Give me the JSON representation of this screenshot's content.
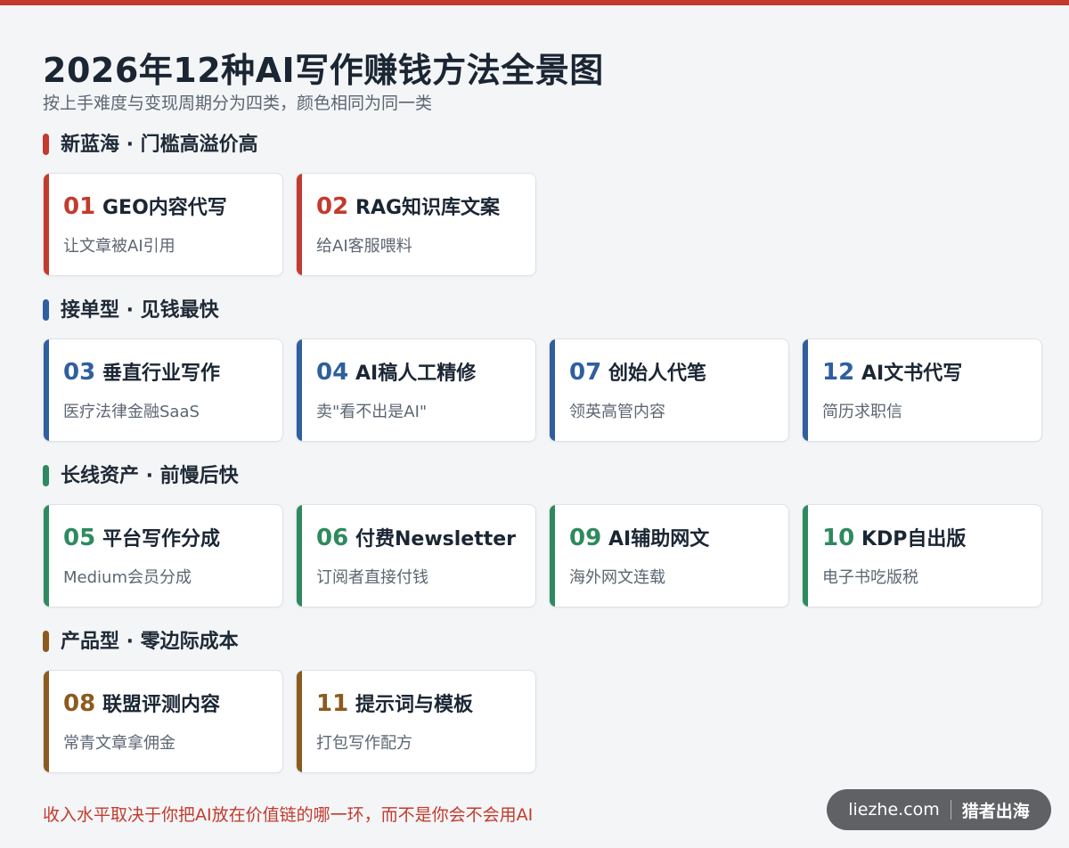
{
  "title": "2026年12种AI写作赚钱方法全景图",
  "subtitle": "按上手难度与变现周期分为四类，颜色相同为同一类",
  "colors": {
    "red": "#c23b2e",
    "blue": "#2f5f9e",
    "green": "#2e8a5e",
    "brown": "#8c5a1e"
  },
  "sections": [
    {
      "title": "新蓝海 · 门槛高溢价高",
      "color": "#c23b2e",
      "cards": [
        {
          "num": "01",
          "title": "GEO内容代写",
          "desc": "让文章被AI引用"
        },
        {
          "num": "02",
          "title": "RAG知识库文案",
          "desc": "给AI客服喂料"
        }
      ]
    },
    {
      "title": "接单型 · 见钱最快",
      "color": "#2f5f9e",
      "cards": [
        {
          "num": "03",
          "title": "垂直行业写作",
          "desc": "医疗法律金融SaaS"
        },
        {
          "num": "04",
          "title": "AI稿人工精修",
          "desc": "卖\"看不出是AI\""
        },
        {
          "num": "07",
          "title": "创始人代笔",
          "desc": "领英高管内容"
        },
        {
          "num": "12",
          "title": "AI文书代写",
          "desc": "简历求职信"
        }
      ]
    },
    {
      "title": "长线资产 · 前慢后快",
      "color": "#2e8a5e",
      "cards": [
        {
          "num": "05",
          "title": "平台写作分成",
          "desc": "Medium会员分成"
        },
        {
          "num": "06",
          "title": "付费Newsletter",
          "desc": "订阅者直接付钱"
        },
        {
          "num": "09",
          "title": "AI辅助网文",
          "desc": "海外网文连载"
        },
        {
          "num": "10",
          "title": "KDP自出版",
          "desc": "电子书吃版税"
        }
      ]
    },
    {
      "title": "产品型 · 零边际成本",
      "color": "#8c5a1e",
      "cards": [
        {
          "num": "08",
          "title": "联盟评测内容",
          "desc": "常青文章拿佣金"
        },
        {
          "num": "11",
          "title": "提示词与模板",
          "desc": "打包写作配方"
        }
      ]
    }
  ],
  "footer": {
    "note": "收入水平取决于你把AI放在价值链的哪一环，而不是你会不会用AI",
    "brand_domain": "liezhe.com",
    "brand_name": "猎者出海"
  }
}
